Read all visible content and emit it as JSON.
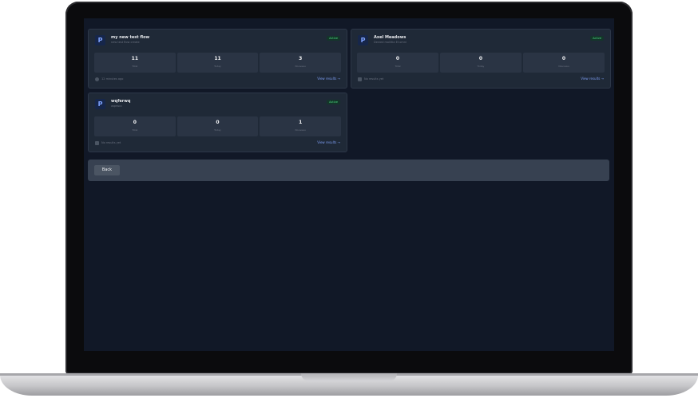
{
  "flows": [
    {
      "name": "my new test flow",
      "subtitle": "new test flow create",
      "status": "Active",
      "logo": "P",
      "stats": [
        {
          "value": "11",
          "label": "Total"
        },
        {
          "value": "11",
          "label": "Today"
        },
        {
          "value": "3",
          "label": "Nouveau"
        }
      ],
      "footer_icon": "clock-icon",
      "footer_text": "12 minutes ago",
      "link": "View results"
    },
    {
      "name": "Axel Meadows",
      "subtitle": "Denied mollitia Et omni",
      "status": "Active",
      "logo": "P",
      "stats": [
        {
          "value": "0",
          "label": "Total"
        },
        {
          "value": "0",
          "label": "Today"
        },
        {
          "value": "0",
          "label": "Nouveau"
        }
      ],
      "footer_icon": "inbox-icon",
      "footer_text": "No results yet",
      "link": "View results"
    },
    {
      "name": "wqferwq",
      "subtitle": "wqewcc",
      "status": "Active",
      "logo": "P",
      "stats": [
        {
          "value": "0",
          "label": "Total"
        },
        {
          "value": "0",
          "label": "Today"
        },
        {
          "value": "1",
          "label": "Nouveau"
        }
      ],
      "footer_icon": "inbox-icon",
      "footer_text": "No results yet",
      "link": "View results"
    }
  ],
  "back_label": "Back",
  "link_arrow": "→",
  "colors": {
    "screen_bg": "#111827",
    "card_bg": "#1f2937",
    "accent": "#7c9cf0",
    "active": "#4ade80"
  }
}
